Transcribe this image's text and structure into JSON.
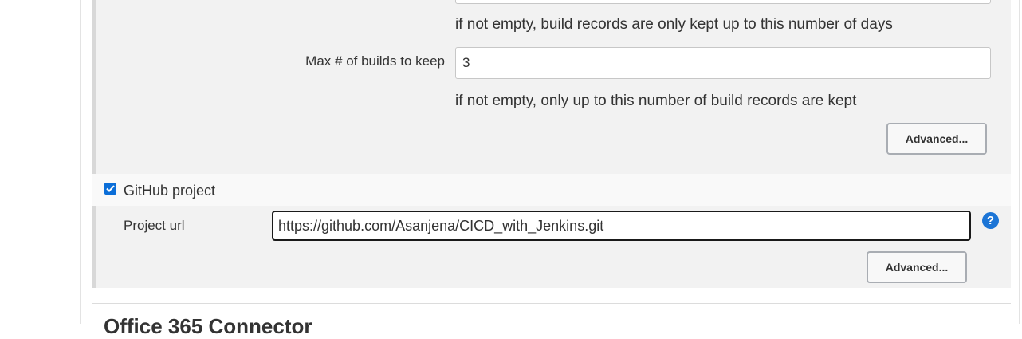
{
  "discard_old_builds": {
    "days_help": "if not empty, build records are only kept up to this number of days",
    "max_builds_label": "Max # of builds to keep",
    "max_builds_value": "3",
    "max_builds_help": "if not empty, only up to this number of build records are kept",
    "advanced_label": "Advanced..."
  },
  "github_project": {
    "checked": true,
    "label": "GitHub project",
    "url_label": "Project url",
    "url_value": "https://github.com/Asanjena/CICD_with_Jenkins.git",
    "help_icon": "question-mark-icon",
    "help_glyph": "?",
    "advanced_label": "Advanced..."
  },
  "next_section": {
    "heading": "Office 365 Connector"
  },
  "colors": {
    "accent": "#0b6ed8",
    "panel": "#f2f2f2",
    "help_icon": "#1c75d6"
  }
}
